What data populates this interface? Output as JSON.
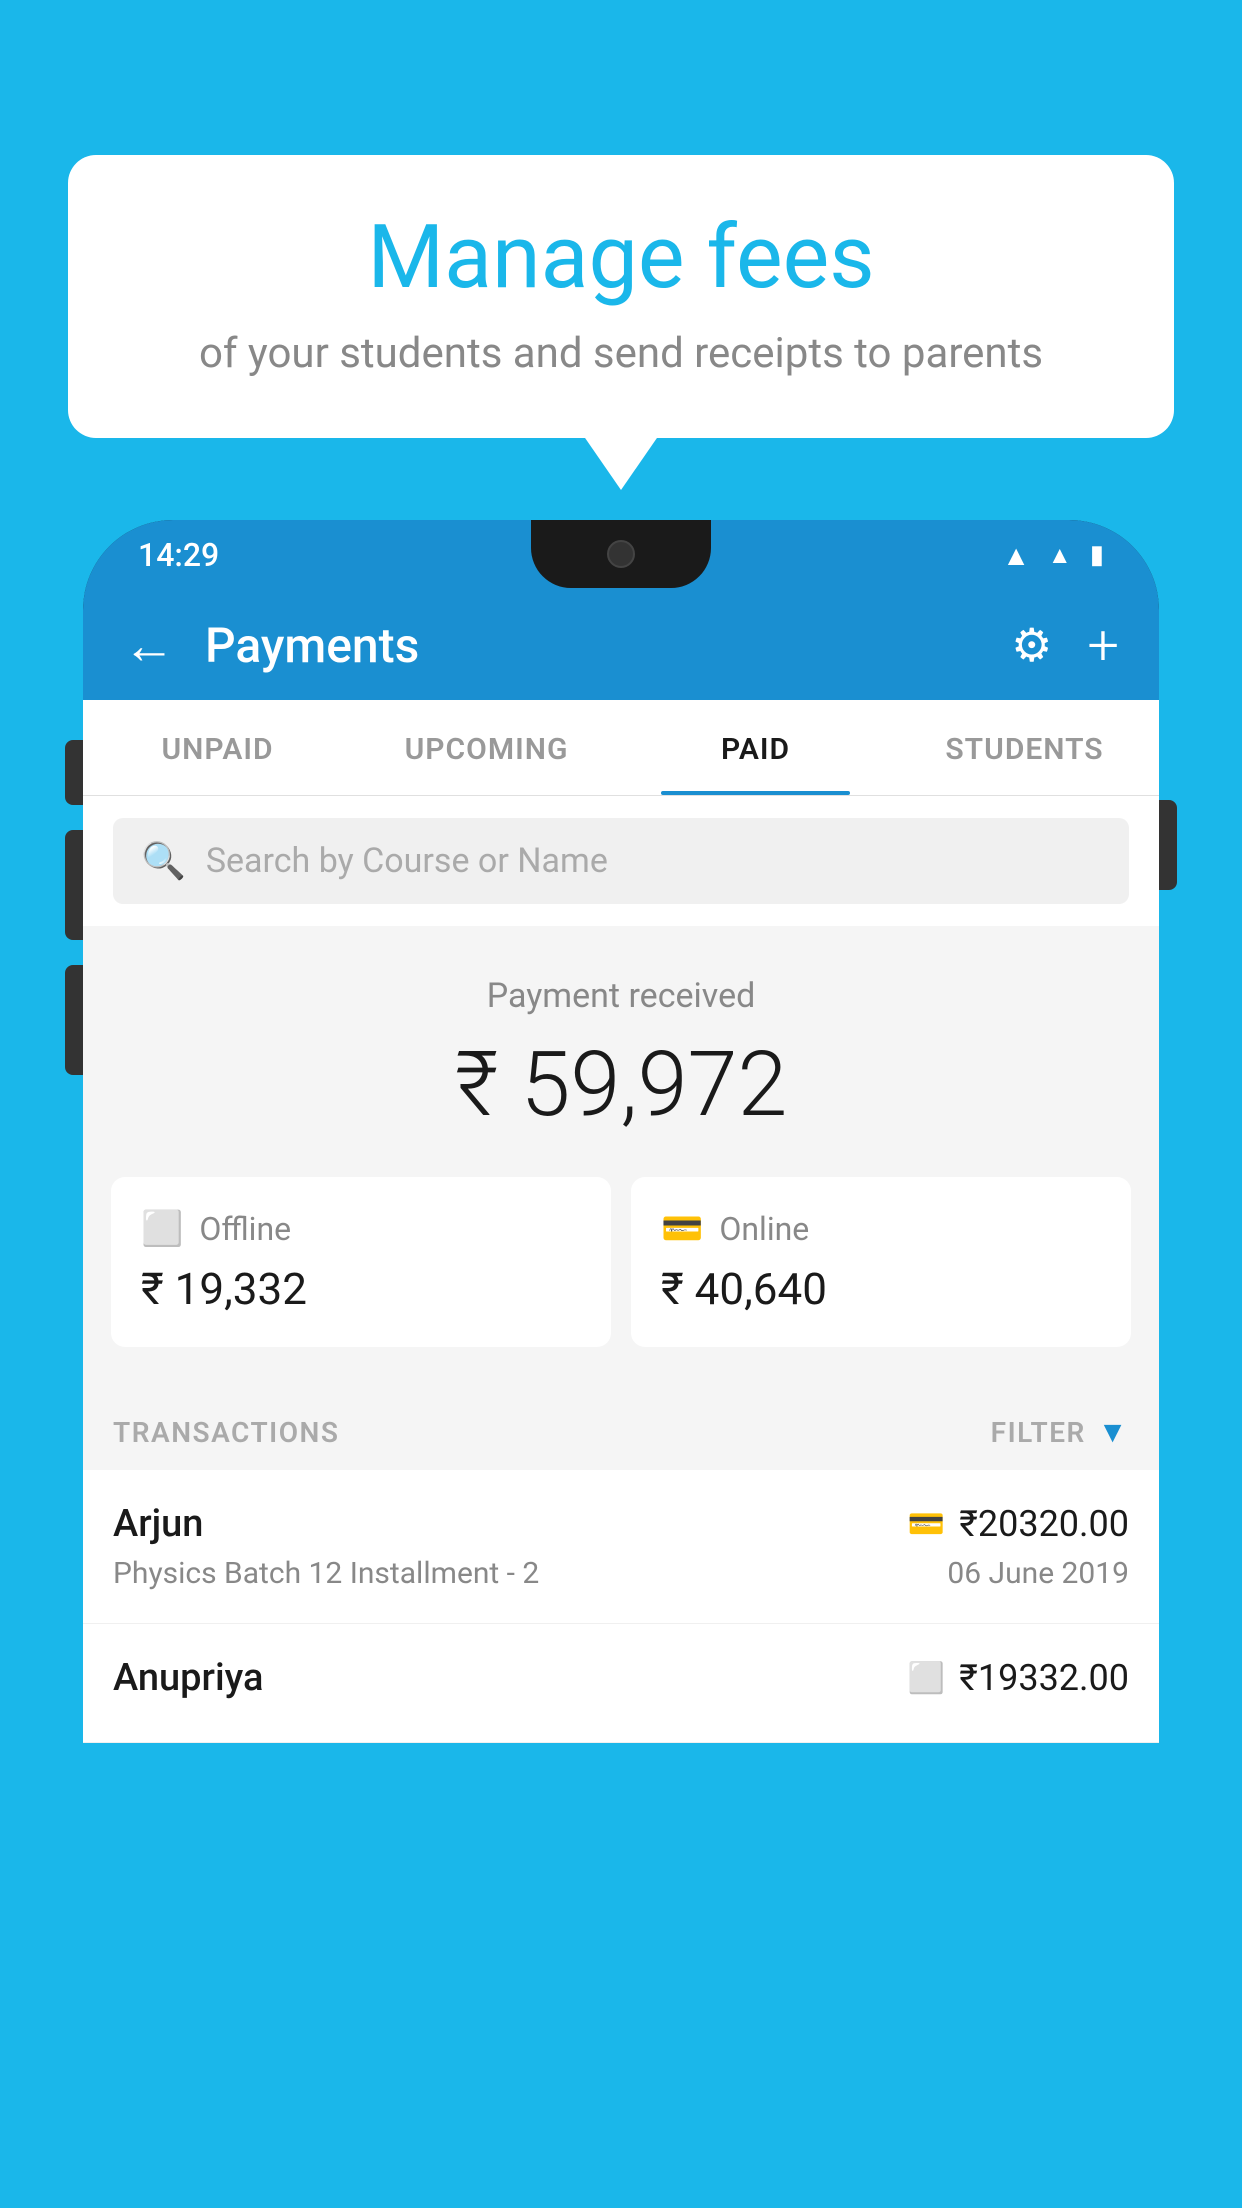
{
  "page": {
    "bg_color": "#1ab7ea"
  },
  "bubble": {
    "title": "Manage fees",
    "subtitle": "of your students and send receipts to parents"
  },
  "status_bar": {
    "time": "14:29",
    "wifi": "▲",
    "signal": "◀",
    "battery": "▮"
  },
  "header": {
    "title": "Payments",
    "back_icon": "←",
    "settings_icon": "⚙",
    "add_icon": "+"
  },
  "tabs": [
    {
      "label": "UNPAID",
      "active": false
    },
    {
      "label": "UPCOMING",
      "active": false
    },
    {
      "label": "PAID",
      "active": true
    },
    {
      "label": "STUDENTS",
      "active": false
    }
  ],
  "search": {
    "placeholder": "Search by Course or Name"
  },
  "payment": {
    "label": "Payment received",
    "amount": "₹ 59,972",
    "offline_label": "Offline",
    "offline_amount": "₹ 19,332",
    "online_label": "Online",
    "online_amount": "₹ 40,640"
  },
  "transactions": {
    "header": "TRANSACTIONS",
    "filter_label": "FILTER",
    "items": [
      {
        "name": "Arjun",
        "course": "Physics Batch 12 Installment - 2",
        "amount": "₹20320.00",
        "date": "06 June 2019",
        "type": "online"
      },
      {
        "name": "Anupriya",
        "course": "",
        "amount": "₹19332.00",
        "date": "",
        "type": "offline"
      }
    ]
  }
}
